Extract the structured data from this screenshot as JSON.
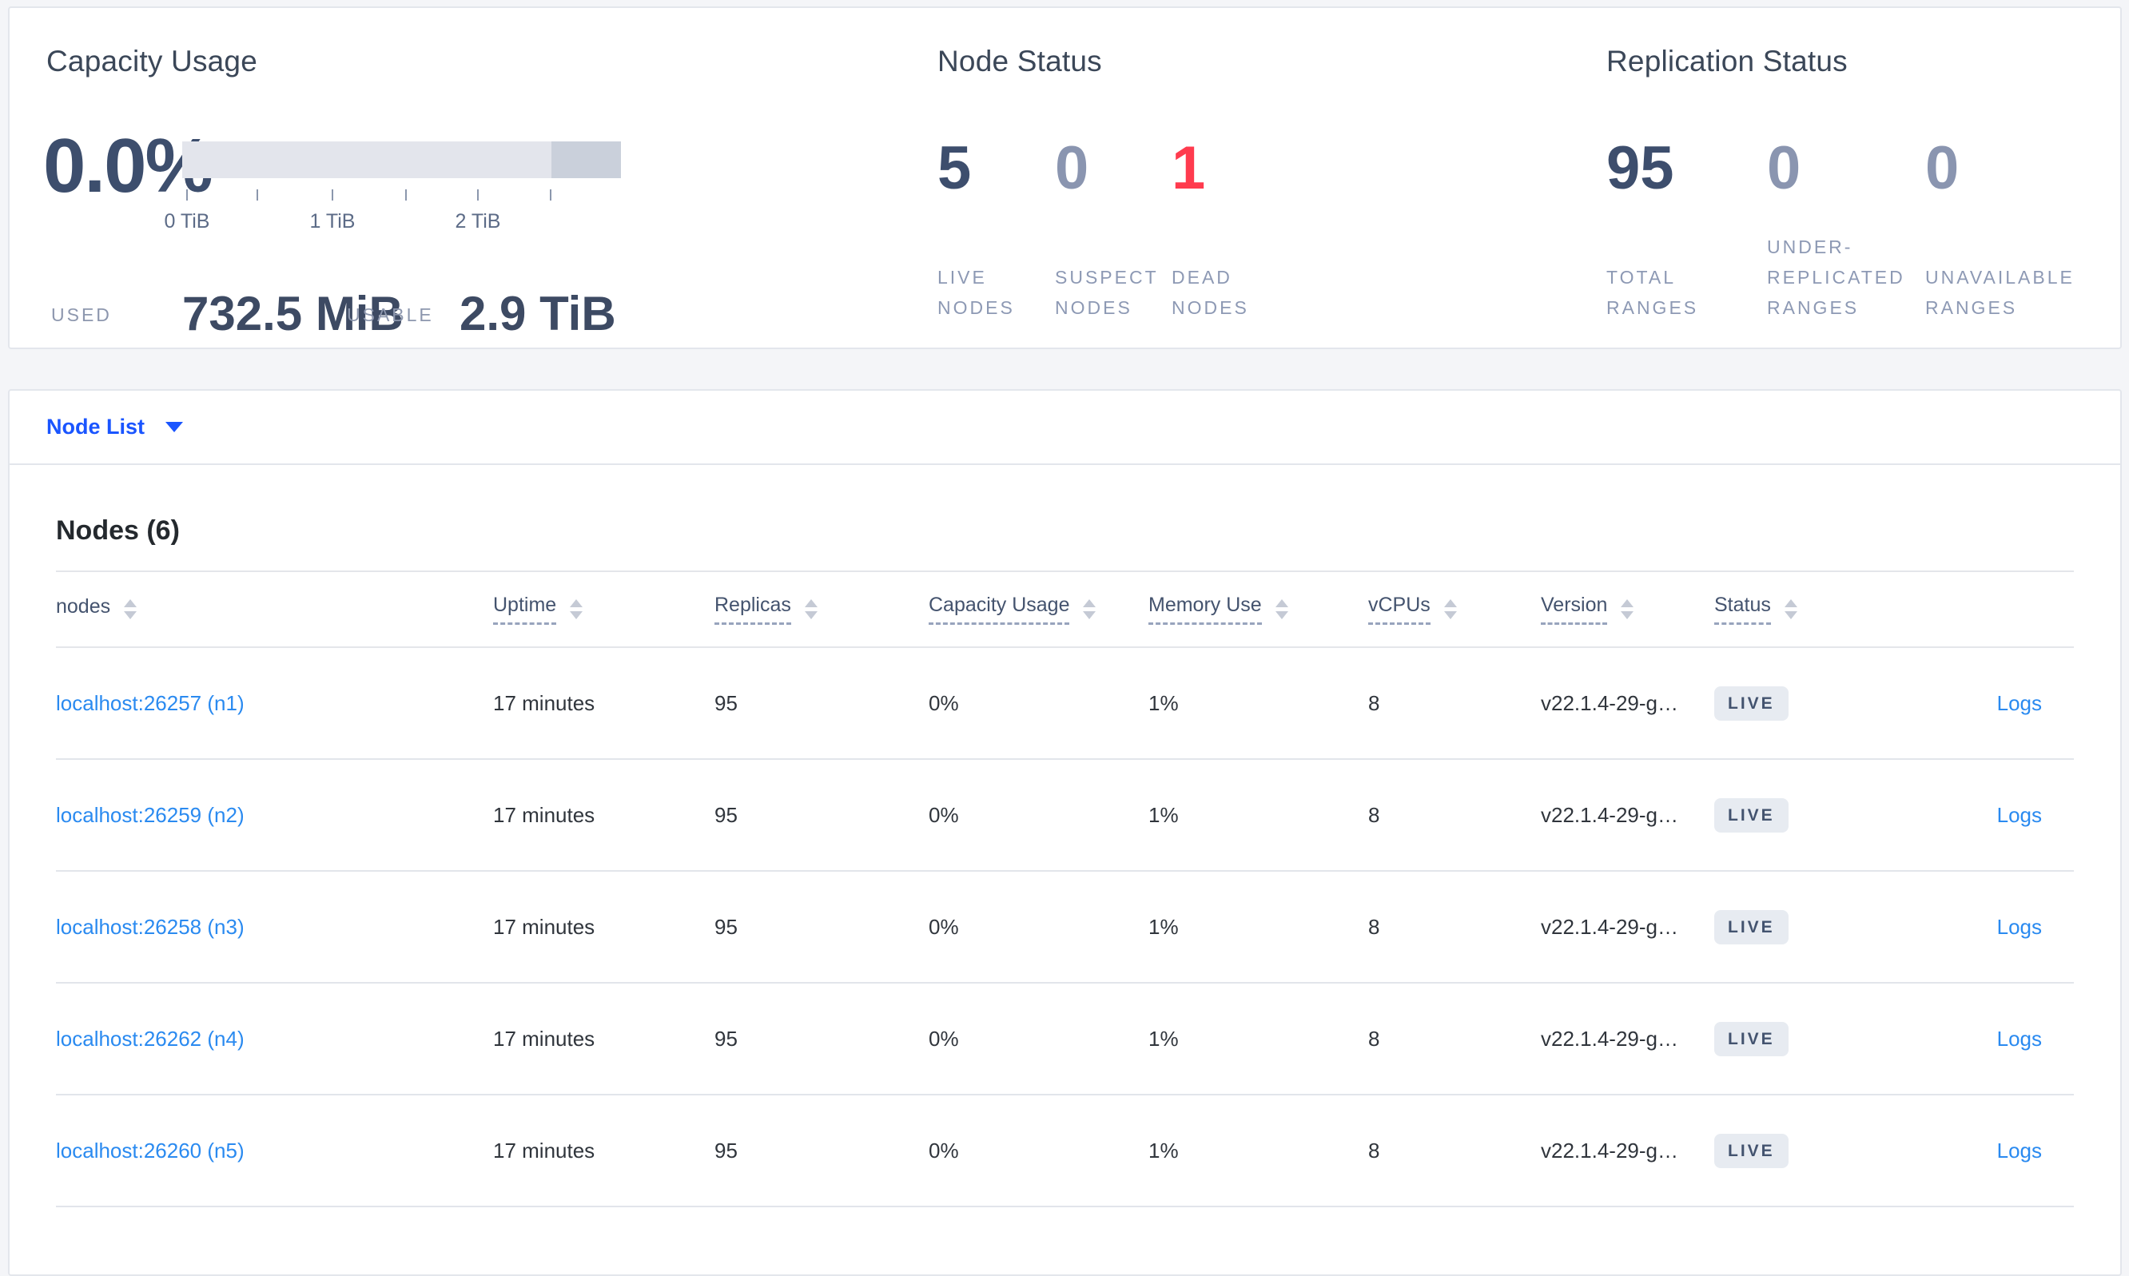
{
  "colors": {
    "link_blue": "#2a8af0",
    "nav_blue": "#1a55ff",
    "danger_red": "#ff3b4e",
    "number_dark": "#3d4e6d",
    "number_muted": "#8a95b0",
    "badge_bg": "#e7ebf1"
  },
  "capacity": {
    "title": "Capacity Usage",
    "percent": "0.0%",
    "ticks": [
      "0 TiB",
      "1 TiB",
      "2 TiB"
    ],
    "used_label": "USED",
    "used_value": "732.5 MiB",
    "usable_label": "USABLE",
    "usable_value": "2.9 TiB"
  },
  "node_status": {
    "title": "Node Status",
    "stats": [
      {
        "value": "5",
        "label": "LIVE NODES"
      },
      {
        "value": "0",
        "label": "SUSPECT NODES"
      },
      {
        "value": "1",
        "label": "DEAD NODES"
      }
    ]
  },
  "replication_status": {
    "title": "Replication Status",
    "stats": [
      {
        "value": "95",
        "label": "TOTAL RANGES"
      },
      {
        "value": "0",
        "label": "UNDER-REPLICATED RANGES"
      },
      {
        "value": "0",
        "label": "UNAVAILABLE RANGES"
      }
    ]
  },
  "node_list": {
    "dropdown_label": "Node List",
    "section_title": "Nodes (6)"
  },
  "table": {
    "columns": [
      "nodes",
      "Uptime",
      "Replicas",
      "Capacity Usage",
      "Memory Use",
      "vCPUs",
      "Version",
      "Status"
    ],
    "rows": [
      {
        "node": "localhost:26257 (n1)",
        "uptime": "17 minutes",
        "replicas": "95",
        "capacity_usage": "0%",
        "memory_use": "1%",
        "vcpus": "8",
        "version": "v22.1.4-29-g…",
        "status": "LIVE",
        "logs": "Logs"
      },
      {
        "node": "localhost:26259 (n2)",
        "uptime": "17 minutes",
        "replicas": "95",
        "capacity_usage": "0%",
        "memory_use": "1%",
        "vcpus": "8",
        "version": "v22.1.4-29-g…",
        "status": "LIVE",
        "logs": "Logs"
      },
      {
        "node": "localhost:26258 (n3)",
        "uptime": "17 minutes",
        "replicas": "95",
        "capacity_usage": "0%",
        "memory_use": "1%",
        "vcpus": "8",
        "version": "v22.1.4-29-g…",
        "status": "LIVE",
        "logs": "Logs"
      },
      {
        "node": "localhost:26262 (n4)",
        "uptime": "17 minutes",
        "replicas": "95",
        "capacity_usage": "0%",
        "memory_use": "1%",
        "vcpus": "8",
        "version": "v22.1.4-29-g…",
        "status": "LIVE",
        "logs": "Logs"
      },
      {
        "node": "localhost:26260 (n5)",
        "uptime": "17 minutes",
        "replicas": "95",
        "capacity_usage": "0%",
        "memory_use": "1%",
        "vcpus": "8",
        "version": "v22.1.4-29-g…",
        "status": "LIVE",
        "logs": "Logs"
      }
    ]
  }
}
